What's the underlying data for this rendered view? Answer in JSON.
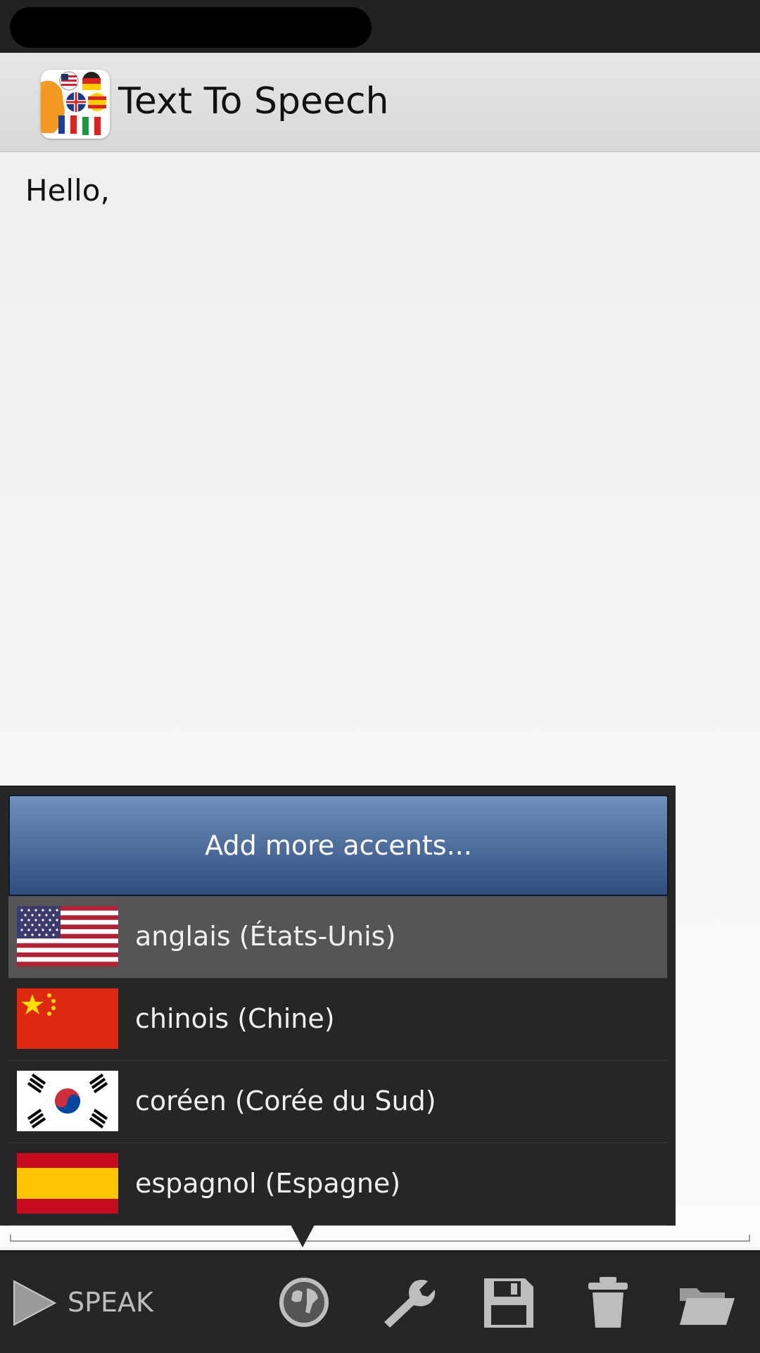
{
  "header": {
    "title": "Text To Speech",
    "icon": "app-logo-icon"
  },
  "editor": {
    "text": "Hello,"
  },
  "popup": {
    "add_button": "Add more accents...",
    "languages": [
      {
        "label": "anglais (États-Unis)",
        "flag": "us-flag-icon",
        "selected": true
      },
      {
        "label": "chinois (Chine)",
        "flag": "china-flag-icon",
        "selected": false
      },
      {
        "label": "coréen (Corée du Sud)",
        "flag": "korea-flag-icon",
        "selected": false
      },
      {
        "label": "espagnol (Espagne)",
        "flag": "spain-flag-icon",
        "selected": false
      }
    ]
  },
  "toolbar": {
    "speak_label": "SPEAK",
    "icons": [
      "play-icon",
      "globe-icon",
      "wrench-icon",
      "save-icon",
      "trash-icon",
      "folder-icon"
    ]
  },
  "colors": {
    "popup_bg": "#262626",
    "selected_row": "#555555",
    "add_button_top": "#6f8fbb",
    "add_button_bottom": "#2f4d7e",
    "toolbar_bg": "#262626",
    "icon_gray": "#b8b8b8"
  }
}
